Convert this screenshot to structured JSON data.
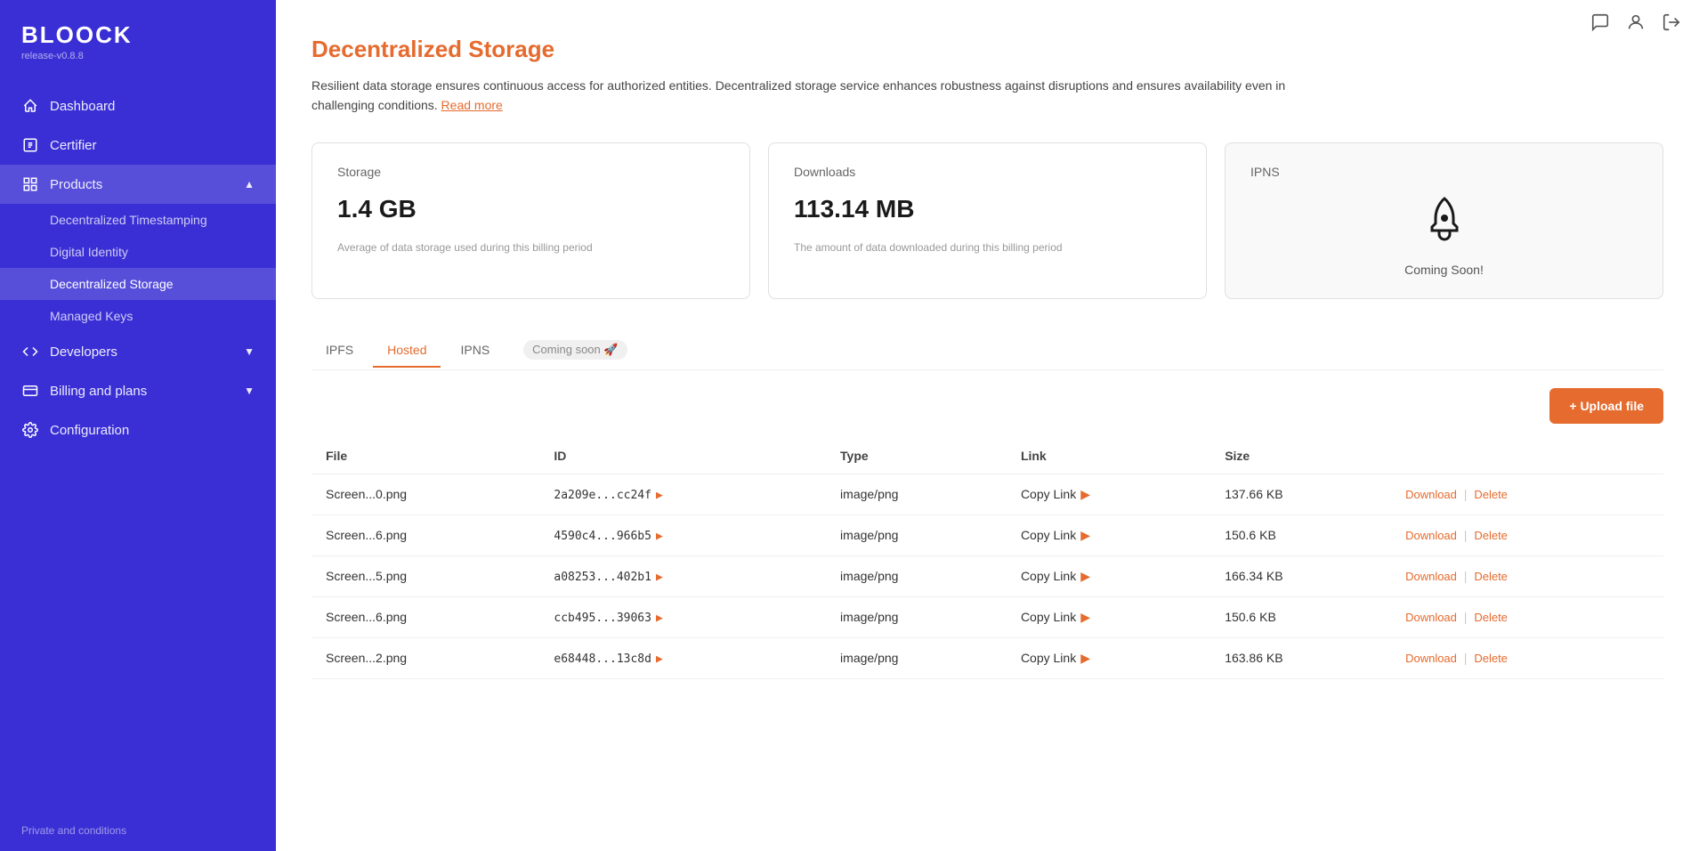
{
  "app": {
    "name": "BLOOCK",
    "version": "release-v0.8.8"
  },
  "sidebar": {
    "nav": [
      {
        "id": "dashboard",
        "label": "Dashboard",
        "icon": "home",
        "active": false
      },
      {
        "id": "certifier",
        "label": "Certifier",
        "icon": "certifier",
        "active": false
      },
      {
        "id": "products",
        "label": "Products",
        "icon": "grid",
        "active": true,
        "expanded": true,
        "children": [
          {
            "id": "decentralized-timestamping",
            "label": "Decentralized Timestamping",
            "active": false
          },
          {
            "id": "digital-identity",
            "label": "Digital Identity",
            "active": false
          },
          {
            "id": "decentralized-storage",
            "label": "Decentralized Storage",
            "active": true
          },
          {
            "id": "managed-keys",
            "label": "Managed Keys",
            "active": false
          }
        ]
      },
      {
        "id": "developers",
        "label": "Developers",
        "icon": "code",
        "active": false,
        "expandable": true
      },
      {
        "id": "billing-plans",
        "label": "Billing and plans",
        "icon": "billing",
        "active": false,
        "expandable": true
      },
      {
        "id": "configuration",
        "label": "Configuration",
        "icon": "config",
        "active": false
      }
    ],
    "footer_label": "Private and conditions"
  },
  "header": {
    "icons": [
      "message",
      "user",
      "logout"
    ]
  },
  "page": {
    "title": "Decentralized Storage",
    "description": "Resilient data storage ensures continuous access for authorized entities. Decentralized storage service enhances robustness against disruptions and ensures availability even in challenging conditions.",
    "read_more_label": "Read more"
  },
  "stats": {
    "storage": {
      "label": "Storage",
      "value": "1.4 GB",
      "description": "Average of data storage used during this billing period"
    },
    "downloads": {
      "label": "Downloads",
      "value": "113.14 MB",
      "description": "The amount of data downloaded during this billing period"
    },
    "ipns": {
      "label": "IPNS",
      "coming_soon_text": "Coming Soon!"
    }
  },
  "tabs": [
    {
      "id": "ipfs",
      "label": "IPFS",
      "active": false
    },
    {
      "id": "hosted",
      "label": "Hosted",
      "active": true
    },
    {
      "id": "ipns",
      "label": "IPNS",
      "active": false
    },
    {
      "id": "coming-soon",
      "label": "Coming soon 🚀",
      "badge": true
    }
  ],
  "upload_button_label": "+ Upload file",
  "table": {
    "columns": [
      "File",
      "ID",
      "Type",
      "Link",
      "Size",
      ""
    ],
    "rows": [
      {
        "file": "Screen...0.png",
        "id": "2a209e...cc24f",
        "type": "image/png",
        "link": "Copy Link",
        "size": "137.66 KB"
      },
      {
        "file": "Screen...6.png",
        "id": "4590c4...966b5",
        "type": "image/png",
        "link": "Copy Link",
        "size": "150.6 KB"
      },
      {
        "file": "Screen...5.png",
        "id": "a08253...402b1",
        "type": "image/png",
        "link": "Copy Link",
        "size": "166.34 KB"
      },
      {
        "file": "Screen...6.png",
        "id": "ccb495...39063",
        "type": "image/png",
        "link": "Copy Link",
        "size": "150.6 KB"
      },
      {
        "file": "Screen...2.png",
        "id": "e68448...13c8d",
        "type": "image/png",
        "link": "Copy Link",
        "size": "163.86 KB"
      }
    ],
    "download_label": "Download",
    "delete_label": "Delete"
  }
}
